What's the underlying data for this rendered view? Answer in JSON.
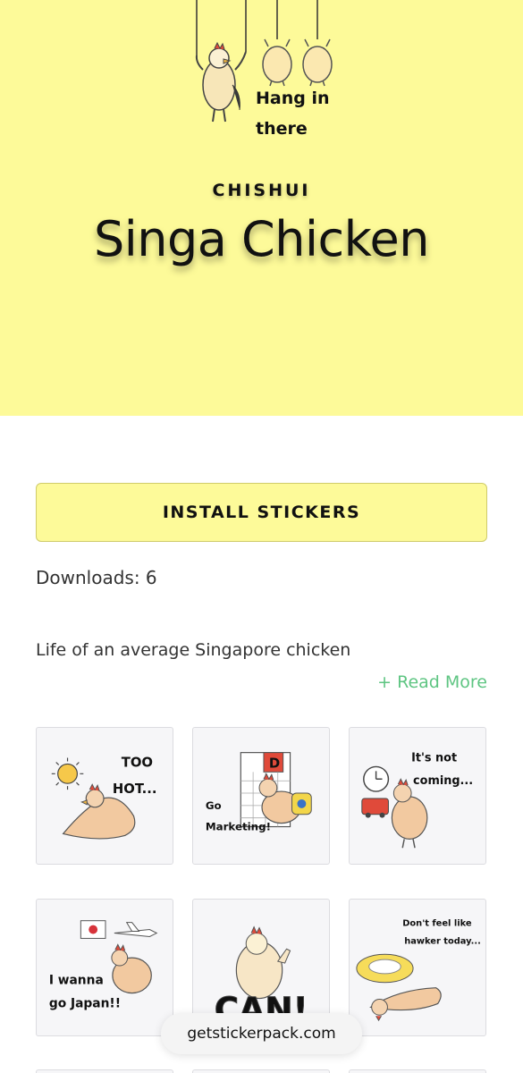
{
  "hero": {
    "banner_caption": "Hang in there",
    "author": "CHISHUI",
    "title": "Singa Chicken"
  },
  "install_button": "INSTALL STICKERS",
  "downloads": "Downloads: 6",
  "description": "Life of an average Singapore chicken",
  "read_more": "+ Read More",
  "stickers": [
    {
      "caption1": "TOO",
      "caption2": "HOT..."
    },
    {
      "caption1": "Go",
      "caption2": "Marketing!"
    },
    {
      "caption1": "It's not",
      "caption2": "coming..."
    },
    {
      "caption1": "I wanna",
      "caption2": "go Japan!!"
    },
    {
      "caption1": "CAN!",
      "caption2": ""
    },
    {
      "caption1": "Don't feel like",
      "caption2": "hawker today..."
    }
  ],
  "site_pill": "getstickerpack.com",
  "colors": {
    "hero_bg": "#fdfa99",
    "button_bg": "#fdfa99",
    "read_more": "#5ec582",
    "card_bg": "#f6f6f8"
  }
}
